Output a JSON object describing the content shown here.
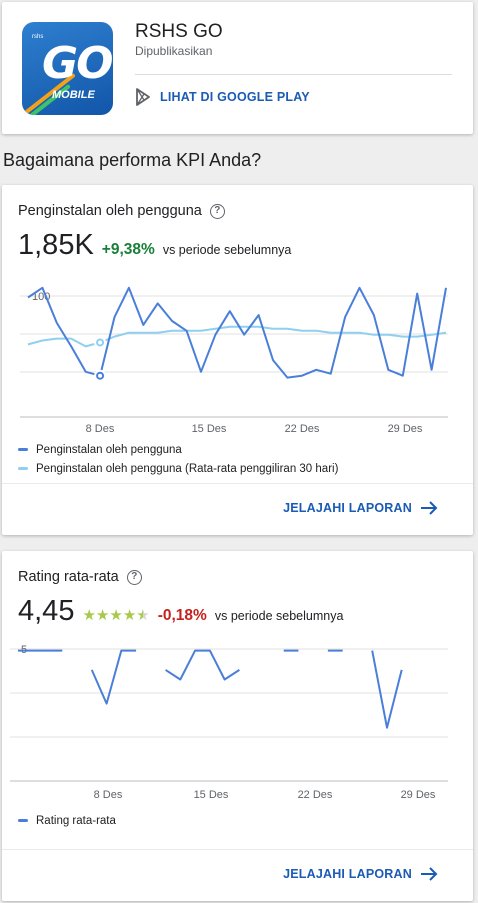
{
  "app": {
    "name": "RSHS GO",
    "status": "Dipublikasikan",
    "play_link": "LIHAT DI GOOGLE PLAY",
    "icon_text": {
      "brand": "rshs",
      "go": "GO",
      "mobile": "MOBILE"
    }
  },
  "section_title": "Bagaimana performa KPI Anda?",
  "installs": {
    "title": "Penginstalan oleh pengguna",
    "value": "1,85K",
    "change": "+9,38%",
    "period": "vs periode sebelumnya",
    "explore": "JELAJAHI LAPORAN",
    "legend": [
      "Penginstalan oleh pengguna",
      "Penginstalan oleh pengguna (Rata-rata penggiliran 30 hari)"
    ]
  },
  "rating": {
    "title": "Rating rata-rata",
    "value": "4,45",
    "change": "-0,18%",
    "period": "vs periode sebelumnya",
    "explore": "JELAJAHI LAPORAN",
    "legend": [
      "Rating rata-rata"
    ]
  },
  "colors": {
    "accent": "#1a5bb5",
    "series_main": "#4a7fd9",
    "series_avg": "#8fcfef",
    "positive": "#188038",
    "negative": "#c5221f",
    "stars": "#a8c94a"
  },
  "chart_data": [
    {
      "type": "line",
      "x_ticks": [
        "8 Des",
        "15 Des",
        "22 Des",
        "29 Des"
      ],
      "y_ticks": [
        "100"
      ],
      "series": [
        {
          "name": "Penginstalan oleh pengguna",
          "values": [
            95,
            100,
            82,
            70,
            57,
            55,
            85,
            100,
            81,
            92,
            83,
            78,
            57,
            76,
            88,
            76,
            86,
            63,
            54,
            55,
            58,
            56,
            85,
            100,
            86,
            58,
            55,
            97,
            58,
            100
          ]
        },
        {
          "name": "Penginstalan oleh pengguna (Rata-rata penggiliran 30 hari)",
          "values": [
            71,
            73,
            74,
            74,
            70,
            72,
            75,
            77,
            77,
            77,
            78,
            78,
            78,
            79,
            80,
            80,
            80,
            79,
            79,
            78,
            78,
            77,
            77,
            77,
            76,
            76,
            75,
            75,
            76,
            77
          ]
        }
      ],
      "ylim": [
        40,
        105
      ],
      "highlight_index": 5
    },
    {
      "type": "line",
      "x_ticks": [
        "8 Des",
        "15 Des",
        "22 Des",
        "29 Des"
      ],
      "y_ticks": [
        "5"
      ],
      "series": [
        {
          "name": "Rating rata-rata",
          "values": [
            5,
            5,
            5,
            5,
            null,
            4.6,
            3.9,
            5,
            5,
            null,
            4.6,
            4.4,
            5,
            5,
            4.4,
            4.6,
            null,
            null,
            5,
            5,
            null,
            5,
            5,
            null,
            5,
            3.4,
            4.6,
            null,
            3.9,
            null
          ]
        }
      ],
      "ylim": [
        3.0,
        5.2
      ]
    }
  ]
}
